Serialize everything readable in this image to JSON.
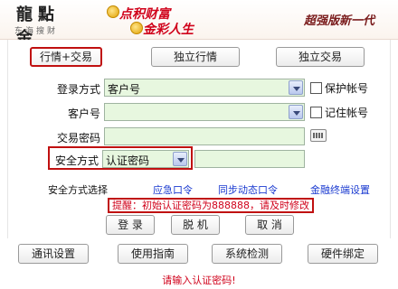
{
  "banner": {
    "logo_text": "龍點金",
    "logo_sub": "东海搜财",
    "slogan_line1": "点积财富",
    "slogan_line2": "金彩人生",
    "version": "超强版新一代"
  },
  "tabs": [
    {
      "label": "行情+交易",
      "active": true
    },
    {
      "label": "独立行情",
      "active": false
    },
    {
      "label": "独立交易",
      "active": false
    }
  ],
  "form": {
    "login_method_label": "登录方式",
    "login_method_value": "客户号",
    "protect_account_label": "保护帐号",
    "customer_no_label": "客户号",
    "customer_no_value": "",
    "remember_account_label": "记住帐号",
    "trade_password_label": "交易密码",
    "trade_password_value": "",
    "security_method_label": "安全方式",
    "security_method_value": "认证密码",
    "security_code_value": ""
  },
  "security_choice": {
    "label": "安全方式选择",
    "links": [
      "应急口令",
      "同步动态口令",
      "金融终端设置"
    ]
  },
  "notice": "提醒：初始认证密码为888888，请及时修改",
  "actions": {
    "login": "登 录",
    "offline": "脱 机",
    "cancel": "取 消"
  },
  "bottom_buttons": [
    "通讯设置",
    "使用指南",
    "系统检测",
    "硬件绑定"
  ],
  "status_text": "请输入认证密码!",
  "colors": {
    "accent_red": "#d0021b",
    "field_green": "#e7f7df",
    "link_blue": "#1a3ad0"
  }
}
